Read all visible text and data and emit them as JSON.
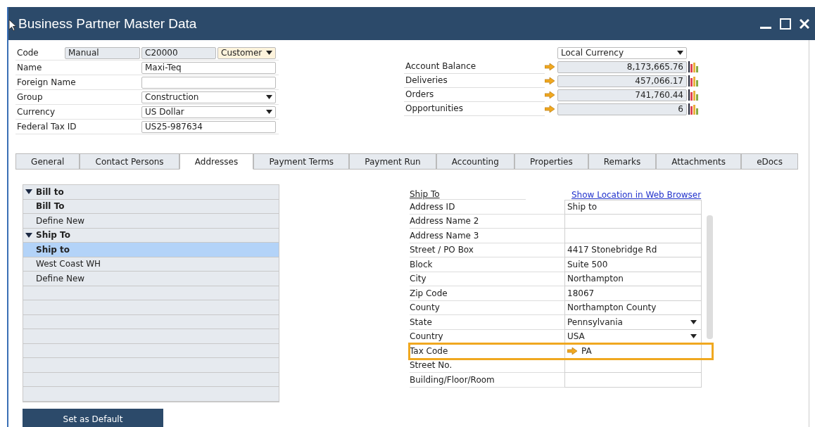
{
  "window": {
    "title": "Business Partner Master Data"
  },
  "header": {
    "fields": [
      {
        "kind": "code",
        "label": "Code",
        "series": "Manual",
        "value": "C20000",
        "type": "Customer"
      },
      {
        "kind": "text",
        "label": "Name",
        "value": "Maxi-Teq"
      },
      {
        "kind": "text",
        "label": "Foreign Name"
      },
      {
        "kind": "dropdown",
        "label": "Group",
        "value": "Construction"
      },
      {
        "kind": "dropdown",
        "label": "Currency",
        "value": "US Dollar"
      },
      {
        "kind": "text",
        "label": "Federal Tax ID",
        "value": "US25-987634"
      }
    ]
  },
  "totals": {
    "currency": "Local Currency",
    "rows": [
      {
        "label": "Account Balance",
        "value": "8,173,665.76"
      },
      {
        "label": "Deliveries",
        "value": "457,066.17"
      },
      {
        "label": "Orders",
        "value": "741,760.44"
      },
      {
        "label": "Opportunities",
        "value": "6"
      }
    ]
  },
  "tabs": [
    {
      "label": "General",
      "selected": false
    },
    {
      "label": "Contact Persons",
      "selected": false
    },
    {
      "label": "Addresses",
      "selected": true
    },
    {
      "label": "Payment Terms",
      "selected": false
    },
    {
      "label": "Payment Run",
      "selected": false
    },
    {
      "label": "Accounting",
      "selected": false
    },
    {
      "label": "Properties",
      "selected": false
    },
    {
      "label": "Remarks",
      "selected": false
    },
    {
      "label": "Attachments",
      "selected": false
    },
    {
      "label": "eDocs",
      "selected": false
    }
  ],
  "tree": [
    {
      "label": "Bill to",
      "expanded": true,
      "children": [
        {
          "label": "Bill To",
          "default": true,
          "selected": false
        },
        {
          "label": "Define New",
          "default": false,
          "selected": false
        }
      ]
    },
    {
      "label": "Ship To",
      "expanded": true,
      "children": [
        {
          "label": "Ship to",
          "default": true,
          "selected": true
        },
        {
          "label": "West Coast WH",
          "default": false,
          "selected": false
        },
        {
          "label": "Define New",
          "default": false,
          "selected": false
        }
      ]
    }
  ],
  "address": {
    "heading": "Ship To",
    "link": "Show Location in Web Browser",
    "fields": [
      {
        "kind": "text",
        "label": "Address ID",
        "value": "Ship to",
        "highlighted": false
      },
      {
        "kind": "text",
        "label": "Address Name 2",
        "highlighted": false
      },
      {
        "kind": "text",
        "label": "Address Name 3",
        "highlighted": false
      },
      {
        "kind": "text",
        "label": "Street / PO Box",
        "value": "4417 Stonebridge Rd",
        "highlighted": false
      },
      {
        "kind": "text",
        "label": "Block",
        "value": "Suite 500",
        "highlighted": false
      },
      {
        "kind": "text",
        "label": "City",
        "value": "Northampton",
        "highlighted": false
      },
      {
        "kind": "text",
        "label": "Zip Code",
        "value": "18067",
        "highlighted": false
      },
      {
        "kind": "text",
        "label": "County",
        "value": "Northampton County",
        "highlighted": false
      },
      {
        "kind": "dropdown",
        "label": "State",
        "value": "Pennsylvania",
        "highlighted": false
      },
      {
        "kind": "dropdown",
        "label": "Country",
        "value": "USA",
        "highlighted": false
      },
      {
        "kind": "linked",
        "label": "Tax Code",
        "value": "PA",
        "highlighted": true
      },
      {
        "kind": "text",
        "label": "Street No.",
        "highlighted": false
      },
      {
        "kind": "text",
        "label": "Building/Floor/Room",
        "highlighted": false
      }
    ]
  },
  "button": "Set as Default"
}
